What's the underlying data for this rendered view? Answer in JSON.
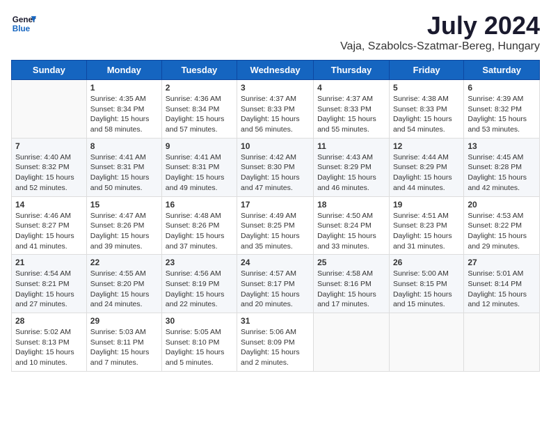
{
  "header": {
    "logo_line1": "General",
    "logo_line2": "Blue",
    "title": "July 2024",
    "location": "Vaja, Szabolcs-Szatmar-Bereg, Hungary"
  },
  "days_of_week": [
    "Sunday",
    "Monday",
    "Tuesday",
    "Wednesday",
    "Thursday",
    "Friday",
    "Saturday"
  ],
  "weeks": [
    [
      {
        "day": "",
        "content": ""
      },
      {
        "day": "1",
        "content": "Sunrise: 4:35 AM\nSunset: 8:34 PM\nDaylight: 15 hours\nand 58 minutes."
      },
      {
        "day": "2",
        "content": "Sunrise: 4:36 AM\nSunset: 8:34 PM\nDaylight: 15 hours\nand 57 minutes."
      },
      {
        "day": "3",
        "content": "Sunrise: 4:37 AM\nSunset: 8:33 PM\nDaylight: 15 hours\nand 56 minutes."
      },
      {
        "day": "4",
        "content": "Sunrise: 4:37 AM\nSunset: 8:33 PM\nDaylight: 15 hours\nand 55 minutes."
      },
      {
        "day": "5",
        "content": "Sunrise: 4:38 AM\nSunset: 8:33 PM\nDaylight: 15 hours\nand 54 minutes."
      },
      {
        "day": "6",
        "content": "Sunrise: 4:39 AM\nSunset: 8:32 PM\nDaylight: 15 hours\nand 53 minutes."
      }
    ],
    [
      {
        "day": "7",
        "content": "Sunrise: 4:40 AM\nSunset: 8:32 PM\nDaylight: 15 hours\nand 52 minutes."
      },
      {
        "day": "8",
        "content": "Sunrise: 4:41 AM\nSunset: 8:31 PM\nDaylight: 15 hours\nand 50 minutes."
      },
      {
        "day": "9",
        "content": "Sunrise: 4:41 AM\nSunset: 8:31 PM\nDaylight: 15 hours\nand 49 minutes."
      },
      {
        "day": "10",
        "content": "Sunrise: 4:42 AM\nSunset: 8:30 PM\nDaylight: 15 hours\nand 47 minutes."
      },
      {
        "day": "11",
        "content": "Sunrise: 4:43 AM\nSunset: 8:29 PM\nDaylight: 15 hours\nand 46 minutes."
      },
      {
        "day": "12",
        "content": "Sunrise: 4:44 AM\nSunset: 8:29 PM\nDaylight: 15 hours\nand 44 minutes."
      },
      {
        "day": "13",
        "content": "Sunrise: 4:45 AM\nSunset: 8:28 PM\nDaylight: 15 hours\nand 42 minutes."
      }
    ],
    [
      {
        "day": "14",
        "content": "Sunrise: 4:46 AM\nSunset: 8:27 PM\nDaylight: 15 hours\nand 41 minutes."
      },
      {
        "day": "15",
        "content": "Sunrise: 4:47 AM\nSunset: 8:26 PM\nDaylight: 15 hours\nand 39 minutes."
      },
      {
        "day": "16",
        "content": "Sunrise: 4:48 AM\nSunset: 8:26 PM\nDaylight: 15 hours\nand 37 minutes."
      },
      {
        "day": "17",
        "content": "Sunrise: 4:49 AM\nSunset: 8:25 PM\nDaylight: 15 hours\nand 35 minutes."
      },
      {
        "day": "18",
        "content": "Sunrise: 4:50 AM\nSunset: 8:24 PM\nDaylight: 15 hours\nand 33 minutes."
      },
      {
        "day": "19",
        "content": "Sunrise: 4:51 AM\nSunset: 8:23 PM\nDaylight: 15 hours\nand 31 minutes."
      },
      {
        "day": "20",
        "content": "Sunrise: 4:53 AM\nSunset: 8:22 PM\nDaylight: 15 hours\nand 29 minutes."
      }
    ],
    [
      {
        "day": "21",
        "content": "Sunrise: 4:54 AM\nSunset: 8:21 PM\nDaylight: 15 hours\nand 27 minutes."
      },
      {
        "day": "22",
        "content": "Sunrise: 4:55 AM\nSunset: 8:20 PM\nDaylight: 15 hours\nand 24 minutes."
      },
      {
        "day": "23",
        "content": "Sunrise: 4:56 AM\nSunset: 8:19 PM\nDaylight: 15 hours\nand 22 minutes."
      },
      {
        "day": "24",
        "content": "Sunrise: 4:57 AM\nSunset: 8:17 PM\nDaylight: 15 hours\nand 20 minutes."
      },
      {
        "day": "25",
        "content": "Sunrise: 4:58 AM\nSunset: 8:16 PM\nDaylight: 15 hours\nand 17 minutes."
      },
      {
        "day": "26",
        "content": "Sunrise: 5:00 AM\nSunset: 8:15 PM\nDaylight: 15 hours\nand 15 minutes."
      },
      {
        "day": "27",
        "content": "Sunrise: 5:01 AM\nSunset: 8:14 PM\nDaylight: 15 hours\nand 12 minutes."
      }
    ],
    [
      {
        "day": "28",
        "content": "Sunrise: 5:02 AM\nSunset: 8:13 PM\nDaylight: 15 hours\nand 10 minutes."
      },
      {
        "day": "29",
        "content": "Sunrise: 5:03 AM\nSunset: 8:11 PM\nDaylight: 15 hours\nand 7 minutes."
      },
      {
        "day": "30",
        "content": "Sunrise: 5:05 AM\nSunset: 8:10 PM\nDaylight: 15 hours\nand 5 minutes."
      },
      {
        "day": "31",
        "content": "Sunrise: 5:06 AM\nSunset: 8:09 PM\nDaylight: 15 hours\nand 2 minutes."
      },
      {
        "day": "",
        "content": ""
      },
      {
        "day": "",
        "content": ""
      },
      {
        "day": "",
        "content": ""
      }
    ]
  ]
}
